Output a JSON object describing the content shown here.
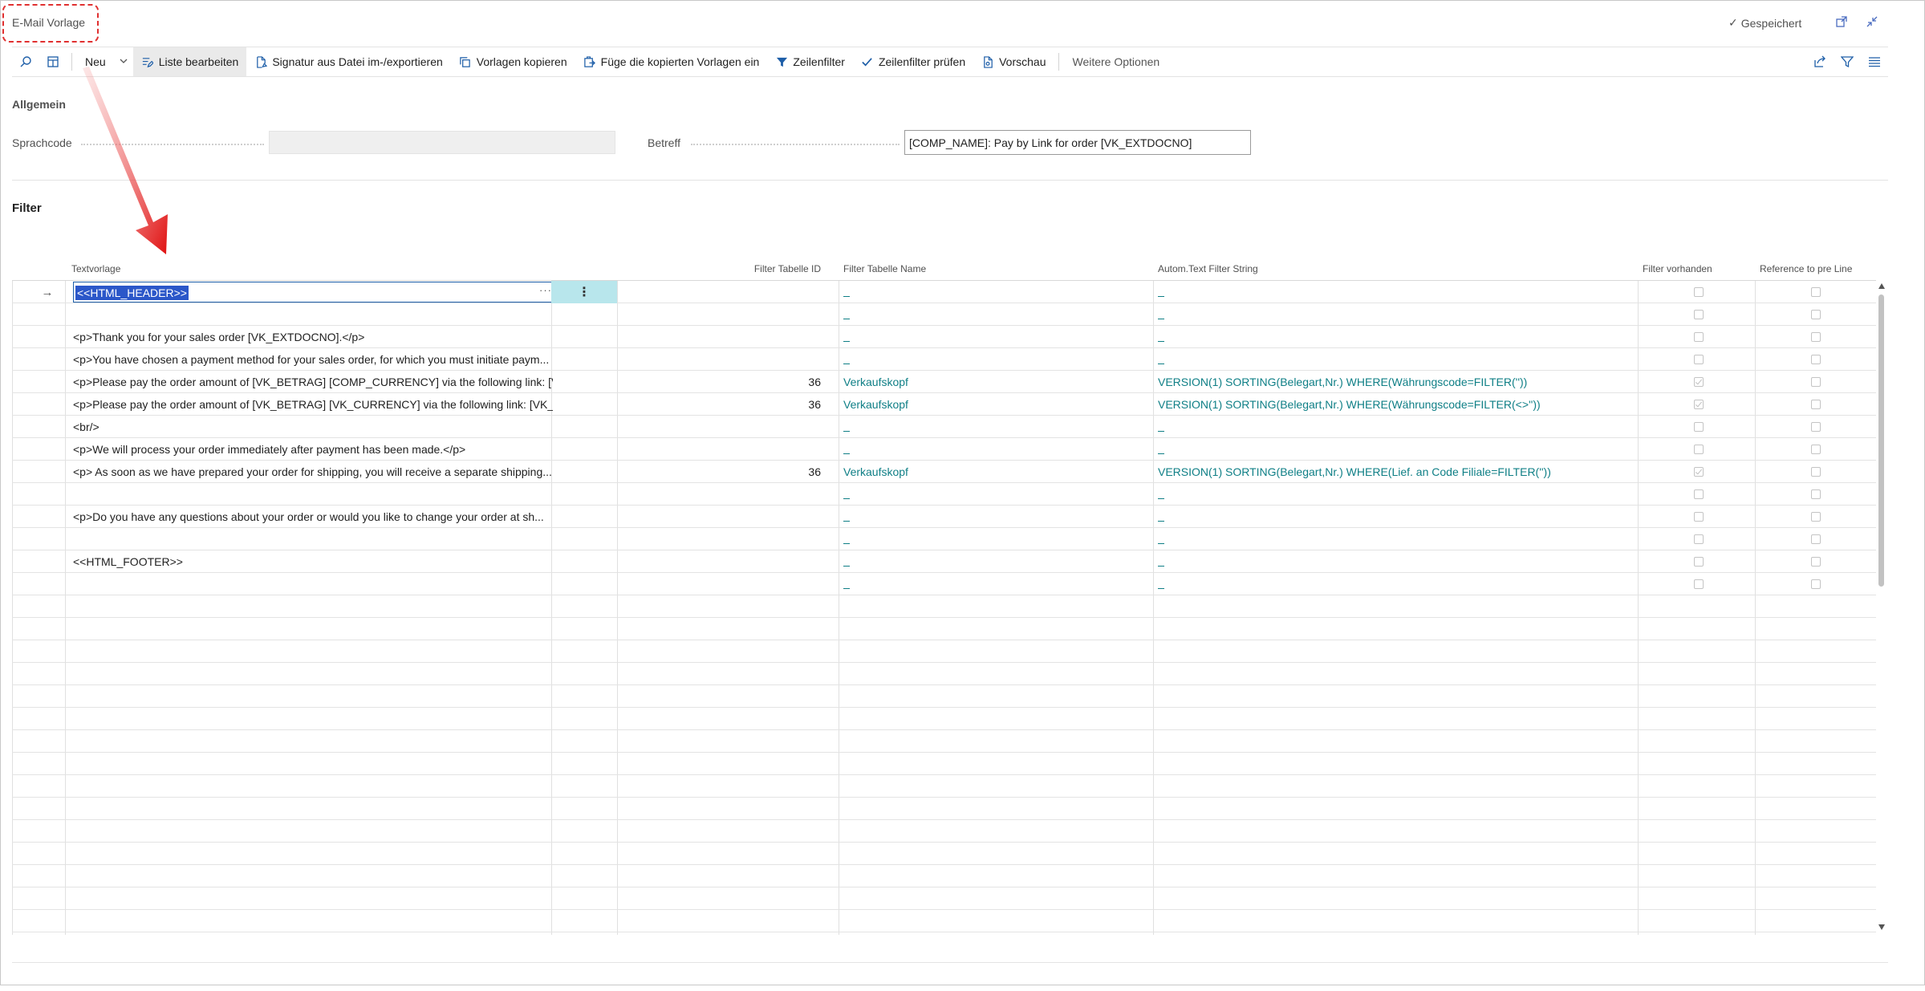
{
  "window": {
    "title": "E-Mail Vorlage",
    "status": "Gespeichert"
  },
  "actions": {
    "new_label": "Neu",
    "edit_list": "Liste bearbeiten",
    "signature": "Signatur aus Datei im-/exportieren",
    "copy_templates": "Vorlagen kopieren",
    "paste_templates": "Füge die kopierten Vorlagen ein",
    "row_filter": "Zeilenfilter",
    "check_row_filter": "Zeilenfilter prüfen",
    "preview": "Vorschau",
    "more_options": "Weitere Optionen"
  },
  "general": {
    "header": "Allgemein",
    "language_label": "Sprachcode",
    "language_value": "",
    "subject_label": "Betreff",
    "subject_value": "[COMP_NAME]: Pay by Link for order [VK_EXTDOCNO]"
  },
  "filter": {
    "header": "Filter",
    "columns": {
      "text": "Textvorlage",
      "table_id": "Filter Tabelle ID",
      "table_name": "Filter Tabelle Name",
      "filter_string": "Autom.Text Filter String",
      "has_filter": "Filter vorhanden",
      "ref_pre_line": "Reference to pre Line"
    },
    "rows": [
      {
        "text": "<<HTML_HEADER>>",
        "table_id": "",
        "table_name": "",
        "filter_string": "",
        "has_filter": false,
        "ref": false,
        "selected": true
      },
      {
        "text": "",
        "table_id": "",
        "table_name": "",
        "filter_string": "",
        "has_filter": false,
        "ref": false
      },
      {
        "text": "<p>Thank you for your sales order [VK_EXTDOCNO].</p>",
        "table_id": "",
        "table_name": "",
        "filter_string": "",
        "has_filter": false,
        "ref": false
      },
      {
        "text": "<p>You have chosen a payment method for your sales order, for which you must initiate paym...",
        "table_id": "",
        "table_name": "",
        "filter_string": "",
        "has_filter": false,
        "ref": false
      },
      {
        "text": "<p>Please pay the order amount of [VK_BETRAG] [COMP_CURRENCY] via the following link: [V...",
        "table_id": "36",
        "table_name": "Verkaufskopf",
        "filter_string": "VERSION(1) SORTING(Belegart,Nr.) WHERE(Währungscode=FILTER(''))",
        "has_filter": true,
        "ref": false
      },
      {
        "text": "<p>Please pay the order amount of [VK_BETRAG] [VK_CURRENCY] via the following link: [VK_P...",
        "table_id": "36",
        "table_name": "Verkaufskopf",
        "filter_string": "VERSION(1) SORTING(Belegart,Nr.) WHERE(Währungscode=FILTER(<>''))",
        "has_filter": true,
        "ref": false
      },
      {
        "text": "<br/>",
        "table_id": "",
        "table_name": "",
        "filter_string": "",
        "has_filter": false,
        "ref": false
      },
      {
        "text": "<p>We will process your order immediately after payment has been made.</p>",
        "table_id": "",
        "table_name": "",
        "filter_string": "",
        "has_filter": false,
        "ref": false
      },
      {
        "text": "<p> As soon as we have prepared your order for shipping, you will receive a separate shipping...",
        "table_id": "36",
        "table_name": "Verkaufskopf",
        "filter_string": "VERSION(1) SORTING(Belegart,Nr.) WHERE(Lief. an Code Filiale=FILTER(''))",
        "has_filter": true,
        "ref": false
      },
      {
        "text": "",
        "table_id": "",
        "table_name": "",
        "filter_string": "",
        "has_filter": false,
        "ref": false
      },
      {
        "text": "<p>Do you have any questions about your order or would you like to change your order at sh...",
        "table_id": "",
        "table_name": "",
        "filter_string": "",
        "has_filter": false,
        "ref": false
      },
      {
        "text": "",
        "table_id": "",
        "table_name": "",
        "filter_string": "",
        "has_filter": false,
        "ref": false
      },
      {
        "text": "<<HTML_FOOTER>>",
        "table_id": "",
        "table_name": "",
        "filter_string": "",
        "has_filter": false,
        "ref": false
      },
      {
        "text": "",
        "table_id": "",
        "table_name": "",
        "filter_string": "",
        "has_filter": false,
        "ref": false
      }
    ]
  },
  "colors": {
    "accent": "#1d5ea8",
    "link_teal": "#0f7f86",
    "selection": "#2b57c9",
    "annotation_red": "#e03030"
  }
}
